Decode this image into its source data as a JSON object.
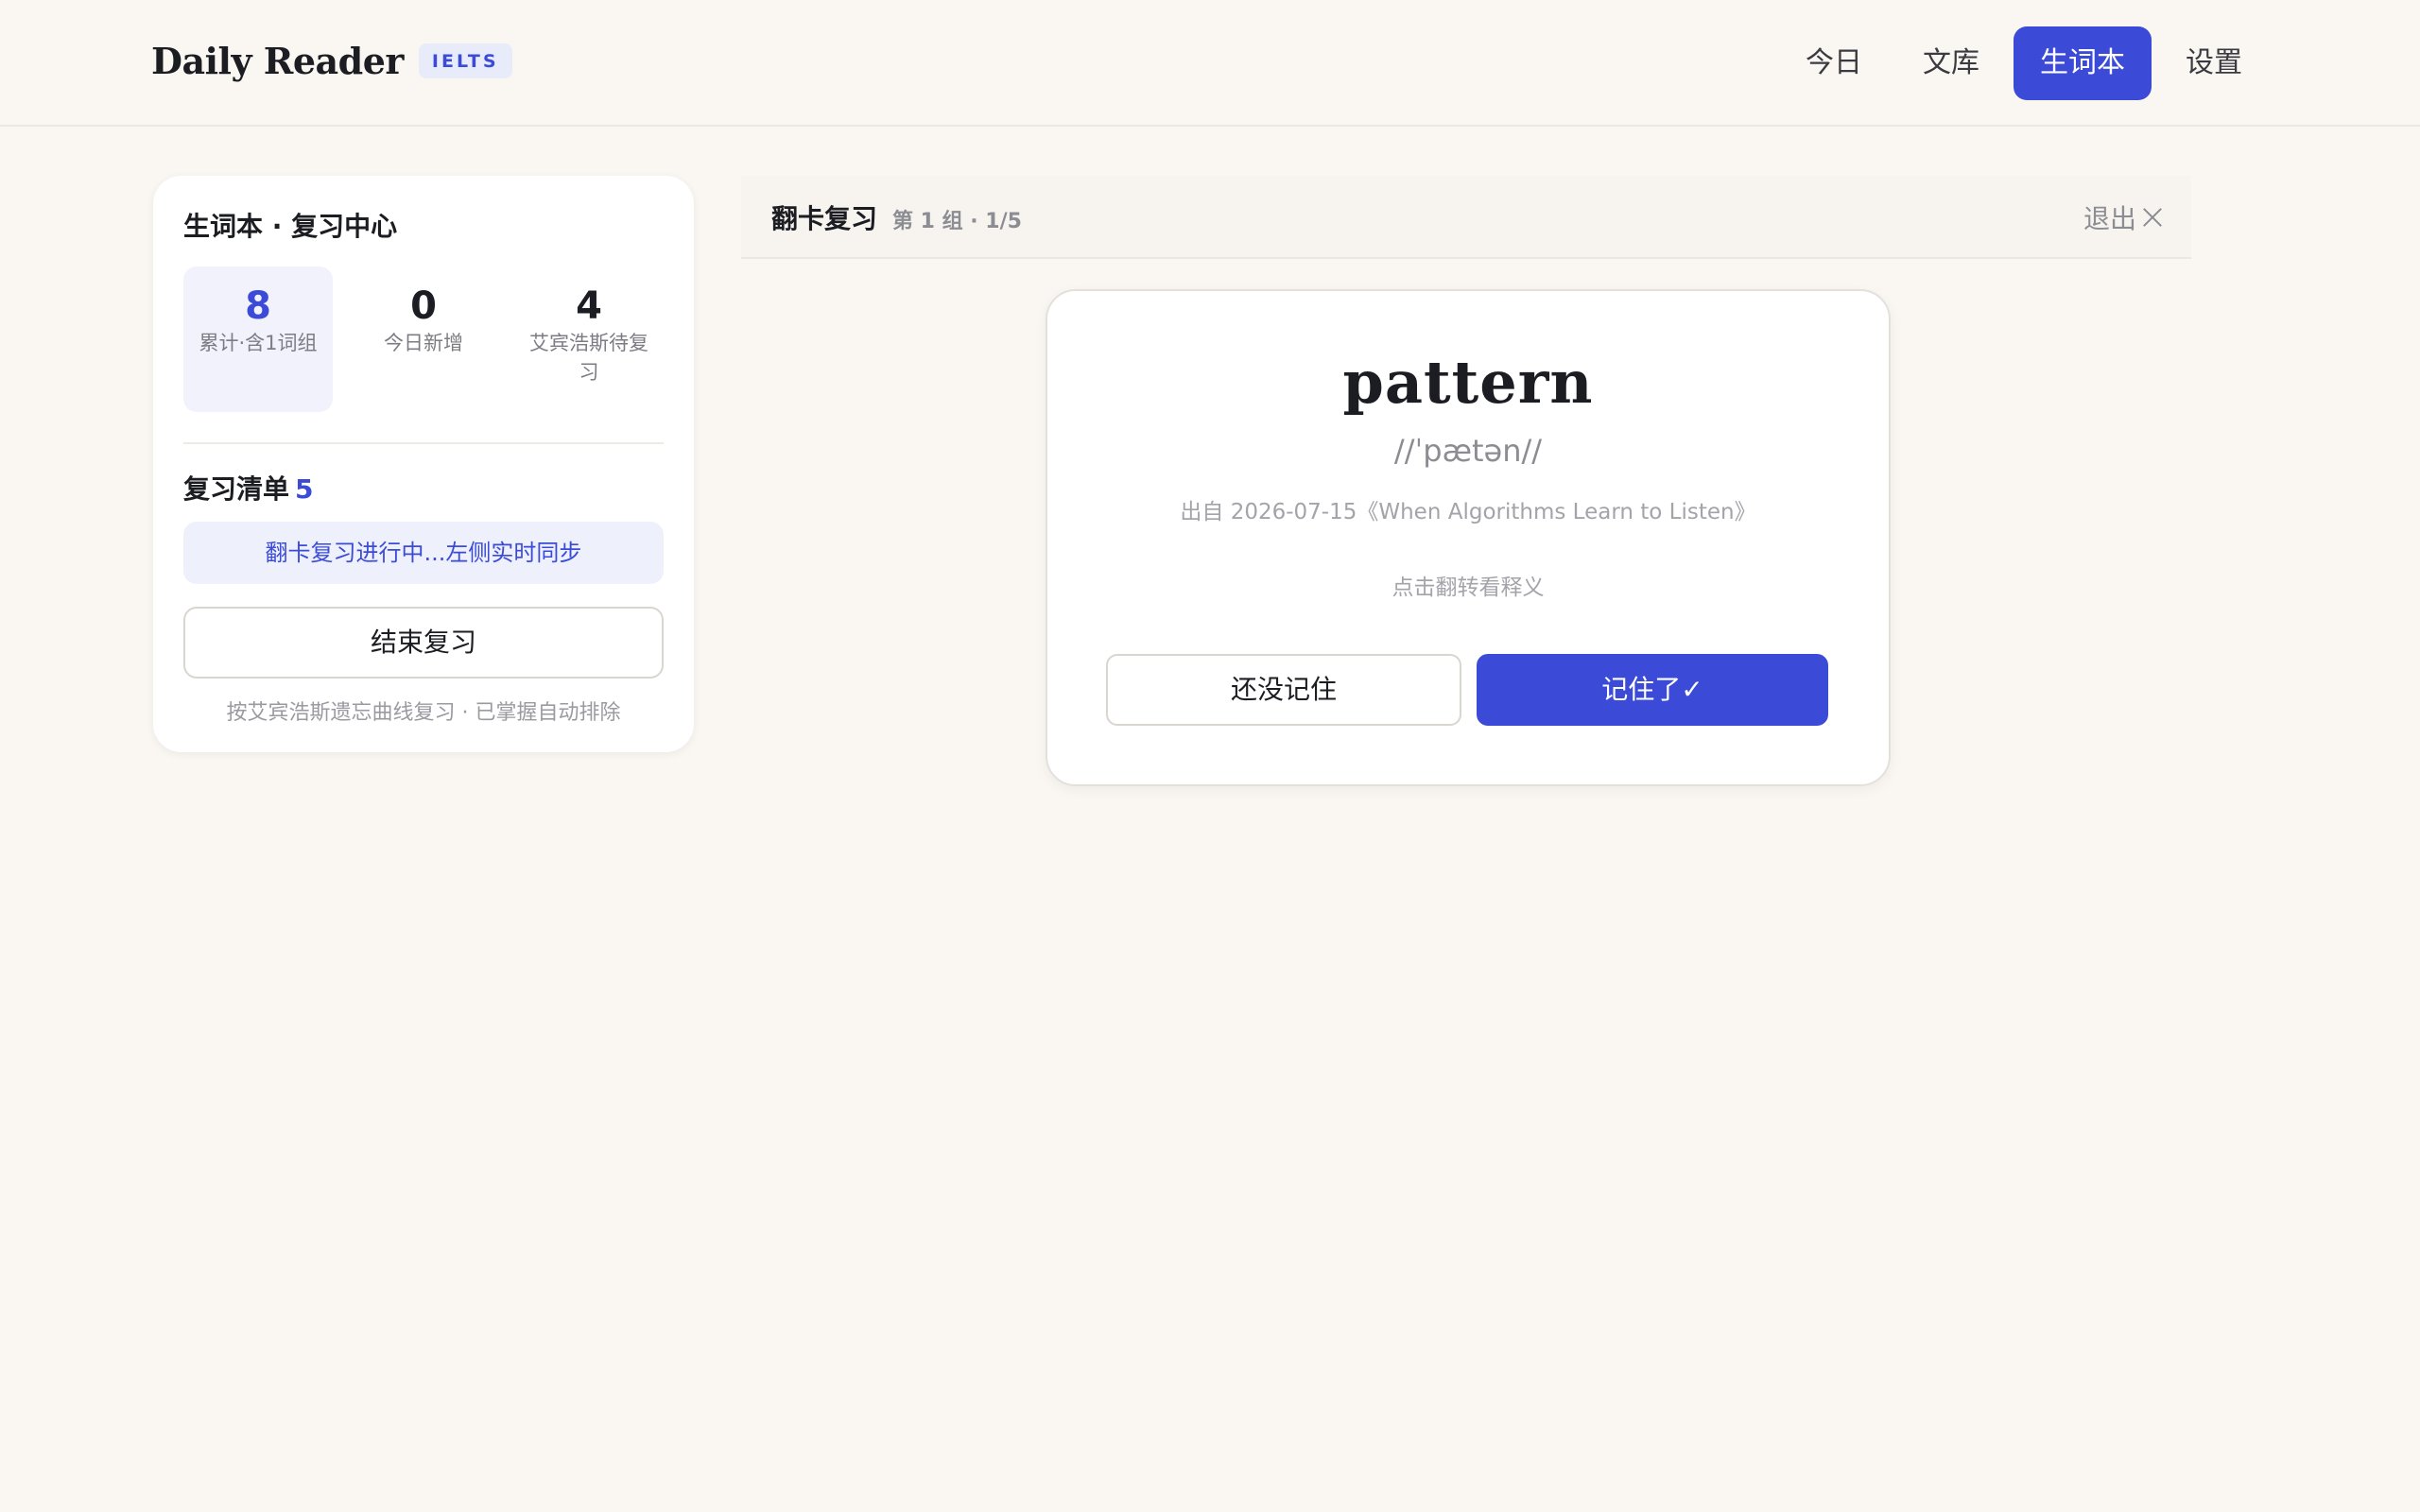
{
  "header": {
    "brand": "Daily Reader",
    "badge": "IELTS",
    "nav": [
      {
        "label": "今日"
      },
      {
        "label": "文库"
      },
      {
        "label": "生词本"
      },
      {
        "label": "设置"
      }
    ],
    "active_nav": "生词本"
  },
  "sidebar": {
    "title": "生词本 · 复习中心",
    "stats": [
      {
        "value": "8",
        "label": "累计·含1词组"
      },
      {
        "value": "0",
        "label": "今日新增"
      },
      {
        "value": "4",
        "label": "艾宾浩斯待复习"
      }
    ],
    "review_list_title": "复习清单",
    "review_list_count": "5",
    "syncing_text": "翻卡复习进行中...左侧实时同步",
    "end_button": "结束复习",
    "hint": "按艾宾浩斯遗忘曲线复习 · 已掌握自动排除"
  },
  "review": {
    "title": "翻卡复习",
    "progress": "第 1 组 · 1/5",
    "exit_label": "退出",
    "exit_icon": "close-icon"
  },
  "card": {
    "word": "pattern",
    "phonetic": "//ˈpætən//",
    "source": "出自 2026-07-15《When Algorithms Learn to Listen》",
    "flip_hint": "点击翻转看释义",
    "not_remembered": "还没记住",
    "remembered": "记住了✓"
  },
  "colors": {
    "accent": "#3b4bd8",
    "background": "#faf7f3"
  }
}
